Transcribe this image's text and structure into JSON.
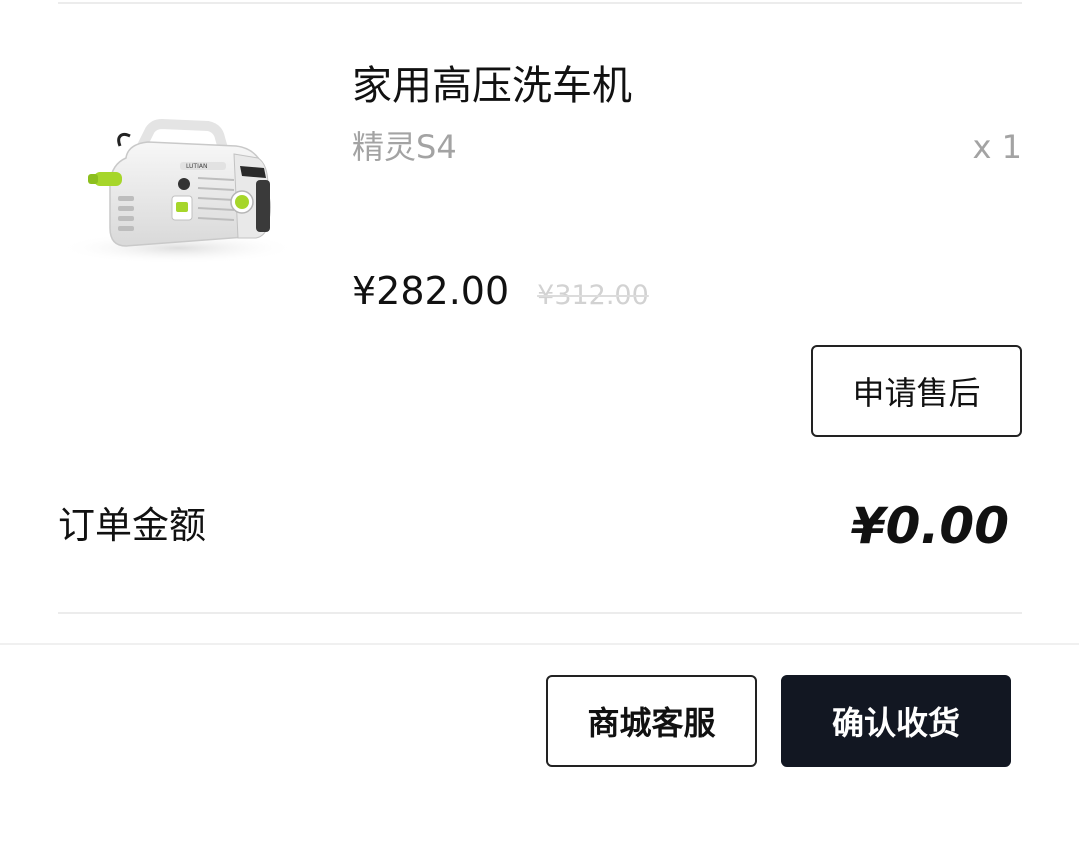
{
  "product": {
    "title": "家用高压洗车机",
    "variant": "精灵S4",
    "quantity": "x 1",
    "price_current": "¥282.00",
    "price_original": "¥312.00",
    "image_icon": "pressure-washer-product-image"
  },
  "actions": {
    "after_sale_label": "申请售后",
    "customer_service_label": "商城客服",
    "confirm_receipt_label": "确认收货"
  },
  "order": {
    "amount_label": "订单金额",
    "amount_value": "¥0.00"
  },
  "colors": {
    "accent_green": "#a6d62a",
    "primary_dark": "#121722",
    "muted_text": "#a3a3a3"
  }
}
